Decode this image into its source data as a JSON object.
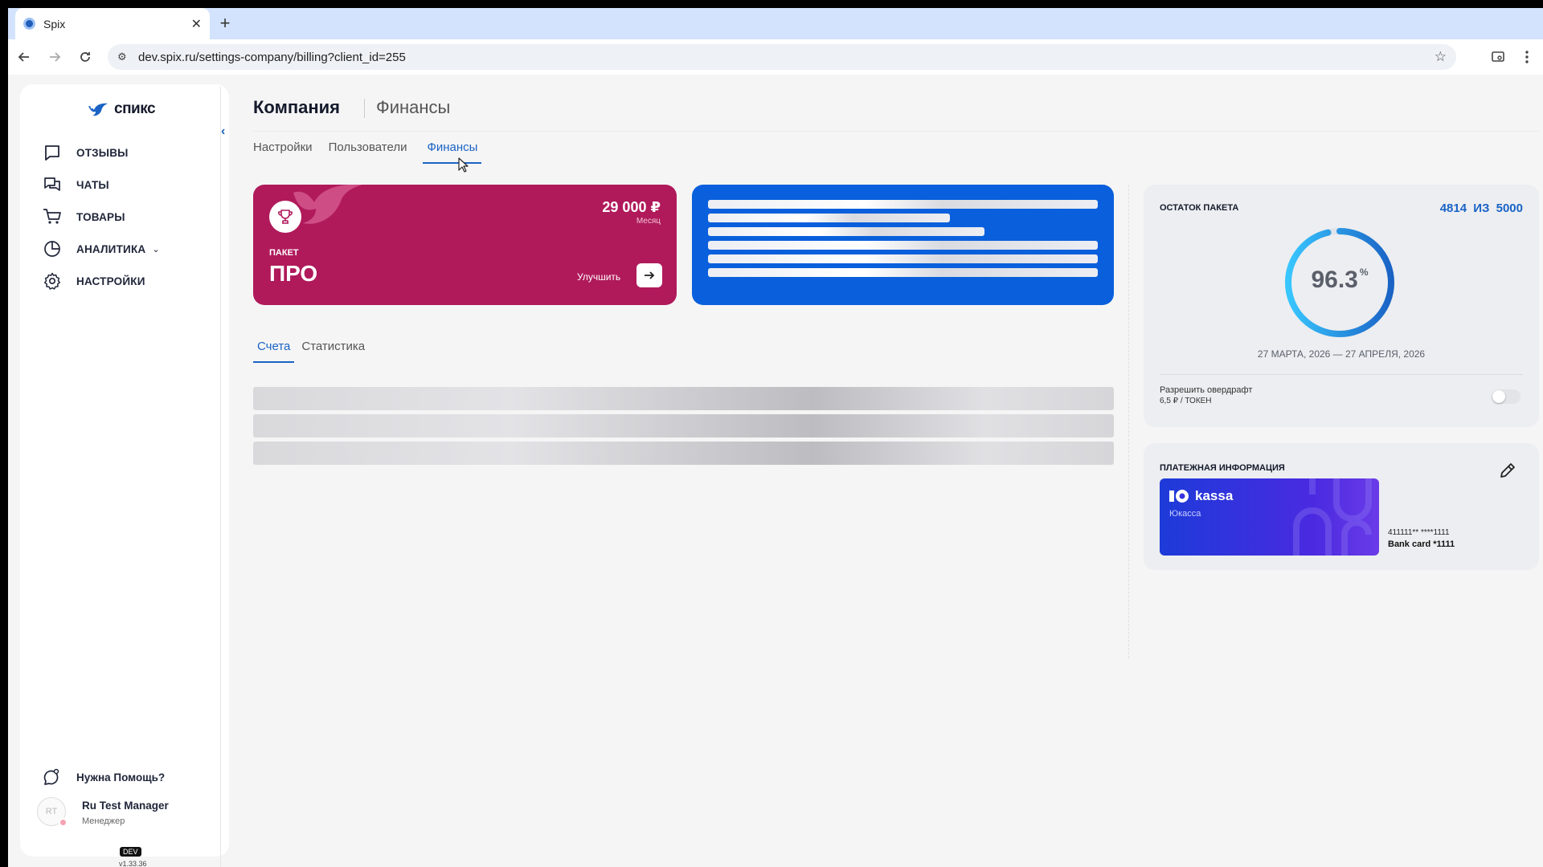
{
  "browser": {
    "tab_title": "Spix",
    "url": "dev.spix.ru/settings-company/billing?client_id=255"
  },
  "sidebar": {
    "logo_text": "спикс",
    "items": [
      {
        "label": "ОТЗЫВЫ",
        "icon": "reviews-icon"
      },
      {
        "label": "ЧАТЫ",
        "icon": "chats-icon"
      },
      {
        "label": "ТОВАРЫ",
        "icon": "cart-icon"
      },
      {
        "label": "АНАЛИТИКА",
        "icon": "analytics-icon"
      },
      {
        "label": "НАСТРОЙКИ",
        "icon": "gear-icon"
      }
    ],
    "help_label": "Нужна Помощь?",
    "user": {
      "initials": "RT",
      "name": "Ru Test Manager",
      "role": "Менеджер"
    },
    "env_badge": "DEV",
    "version": "v1.33.36"
  },
  "header": {
    "title": "Компания",
    "subtitle": "Финансы"
  },
  "tabs": [
    {
      "label": "Настройки",
      "active": false
    },
    {
      "label": "Пользователи",
      "active": false
    },
    {
      "label": "Финансы",
      "active": true
    }
  ],
  "plan_card": {
    "price": "29 000 ₽",
    "period": "Месяц",
    "package_label": "ПАКЕТ",
    "plan_name": "ПРО",
    "upgrade_label": "Улучшить",
    "color": "#b01a5b"
  },
  "promo_card": {
    "color": "#0a5fdc"
  },
  "subtabs": [
    {
      "label": "Счета",
      "active": true
    },
    {
      "label": "Статистика",
      "active": false
    }
  ],
  "balance": {
    "title": "ОСТАТОК ПАКЕТА",
    "used": "4814",
    "of_label": "ИЗ",
    "total": "5000",
    "percent": "96.3",
    "percent_value": 96.3,
    "percent_sign": "%",
    "dates": "27 МАРТА, 2026 — 27 АПРЕЛЯ, 2026",
    "overdraft_label": "Разрешить овердрафт",
    "overdraft_price": "6,5 ₽ / ТОКЕН",
    "overdraft_enabled": false
  },
  "payment": {
    "title": "ПЛАТЕЖНАЯ ИНФОРМАЦИЯ",
    "provider_name": "kassa",
    "provider_sub": "Юкасса",
    "card_number": "411111** ****1111",
    "card_label": "Bank card *1111"
  },
  "colors": {
    "accent": "#1a63c5",
    "ring_start": "#38c6ff",
    "ring_end": "#1a63c5"
  }
}
